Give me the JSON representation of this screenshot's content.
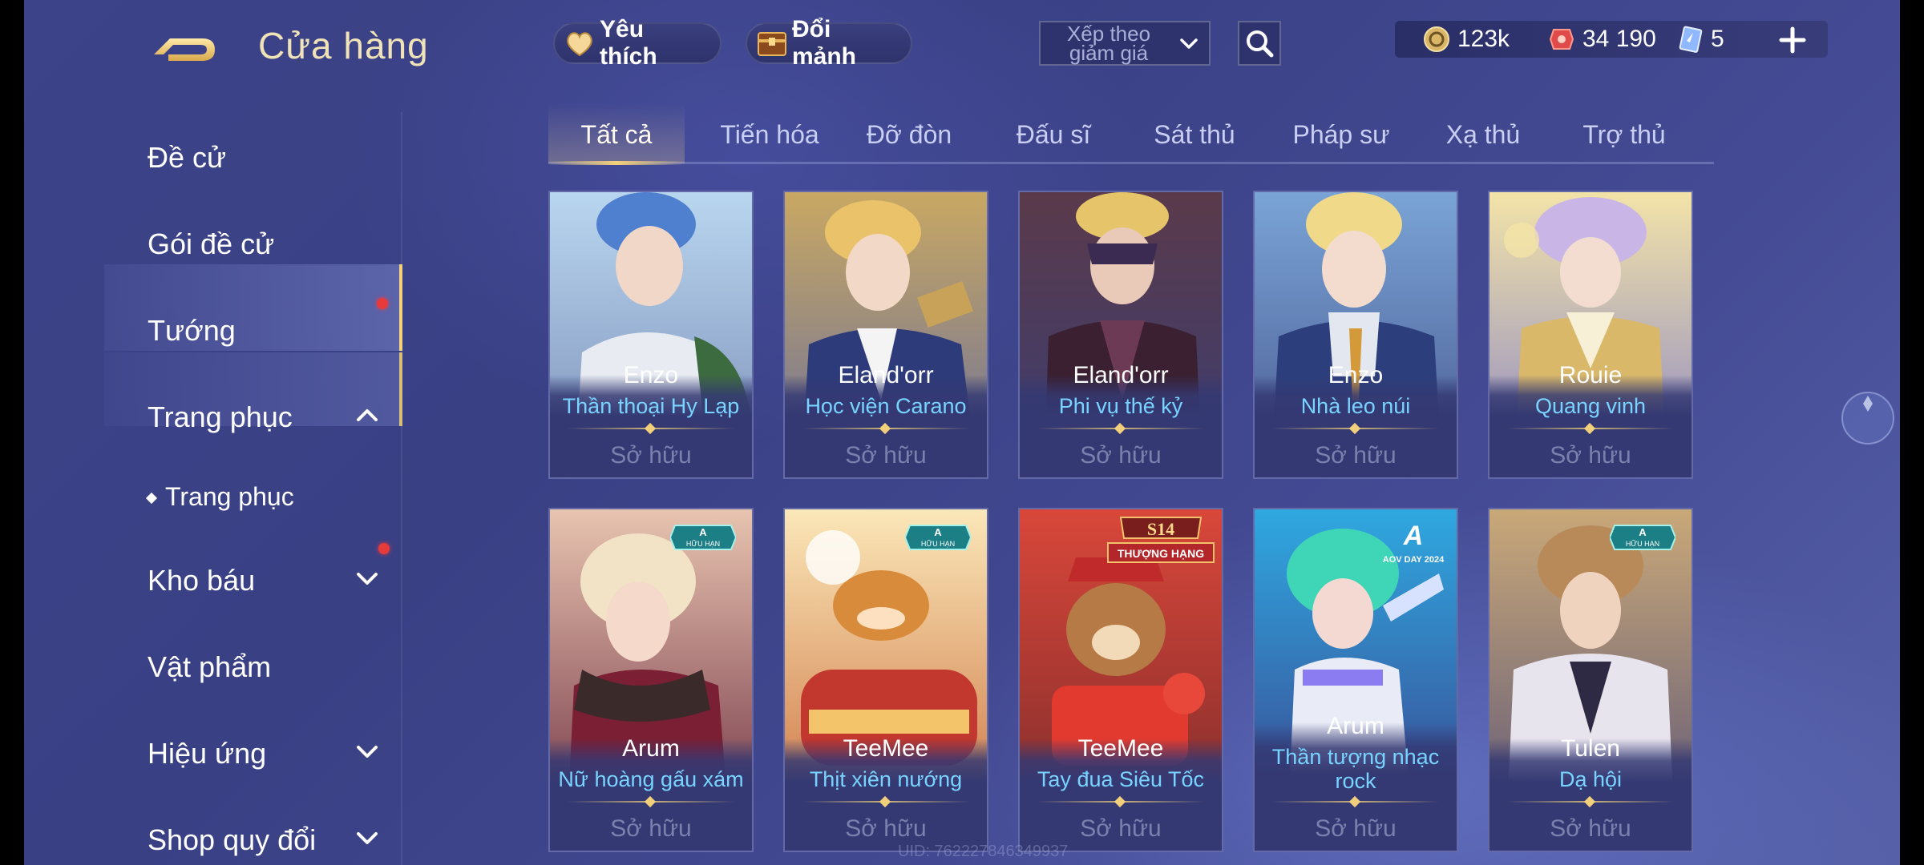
{
  "header": {
    "title": "Cửa hàng",
    "favorites_label": "Yêu thích",
    "exchange_label": "Đổi mảnh",
    "sort_label": "Xếp theo giảm giá"
  },
  "currency": {
    "gold": "123k",
    "vouchers": "34 190",
    "tickets": "5"
  },
  "sidebar": {
    "items": [
      {
        "label": "Đề cử"
      },
      {
        "label": "Gói đề cử"
      },
      {
        "label": "Tướng"
      },
      {
        "label": "Trang phục"
      },
      {
        "label": "Kho báu"
      },
      {
        "label": "Vật phẩm"
      },
      {
        "label": "Hiệu ứng"
      },
      {
        "label": "Shop quy đổi"
      }
    ],
    "sub_item": "Trang phục"
  },
  "tabs": [
    "Tất cả",
    "Tiến hóa",
    "Đỡ đòn",
    "Đấu sĩ",
    "Sát thủ",
    "Pháp sư",
    "Xạ thủ",
    "Trợ thủ"
  ],
  "cards": [
    {
      "hero": "Enzo",
      "skin": "Thần thoại Hy Lạp",
      "status": "Sở hữu"
    },
    {
      "hero": "Eland'orr",
      "skin": "Học viện Carano",
      "status": "Sở hữu"
    },
    {
      "hero": "Eland'orr",
      "skin": "Phi vụ thế kỷ",
      "status": "Sở hữu"
    },
    {
      "hero": "Enzo",
      "skin": "Nhà leo núi",
      "status": "Sở hữu"
    },
    {
      "hero": "Rouie",
      "skin": "Quang vinh",
      "status": "Sở hữu"
    },
    {
      "hero": "Arum",
      "skin": "Nữ hoàng gấu xám",
      "status": "Sở hữu",
      "badge": "HỮU HẠN"
    },
    {
      "hero": "TeeMee",
      "skin": "Thịt xiên nướng",
      "status": "Sở hữu",
      "badge": "HỮU HẠN"
    },
    {
      "hero": "TeeMee",
      "skin": "Tay đua Siêu Tốc",
      "status": "Sở hữu",
      "badge_title": "S14",
      "badge_sub": "THƯỢNG HẠNG"
    },
    {
      "hero": "Arum",
      "skin": "Thần tượng nhạc rock",
      "status": "Sở hữu",
      "badge_sub": "AOV DAY 2024"
    },
    {
      "hero": "Tulen",
      "skin": "Dạ hội",
      "status": "Sở hữu",
      "badge": "HỮU HẠN"
    }
  ],
  "footer": {
    "uid": "UID: 762227846349937"
  },
  "colors": {
    "accent_gold": "#f3d27a",
    "skin_name": "#78d4ff",
    "owned_text": "#7b80ad",
    "notify_dot": "#e73a3a"
  }
}
